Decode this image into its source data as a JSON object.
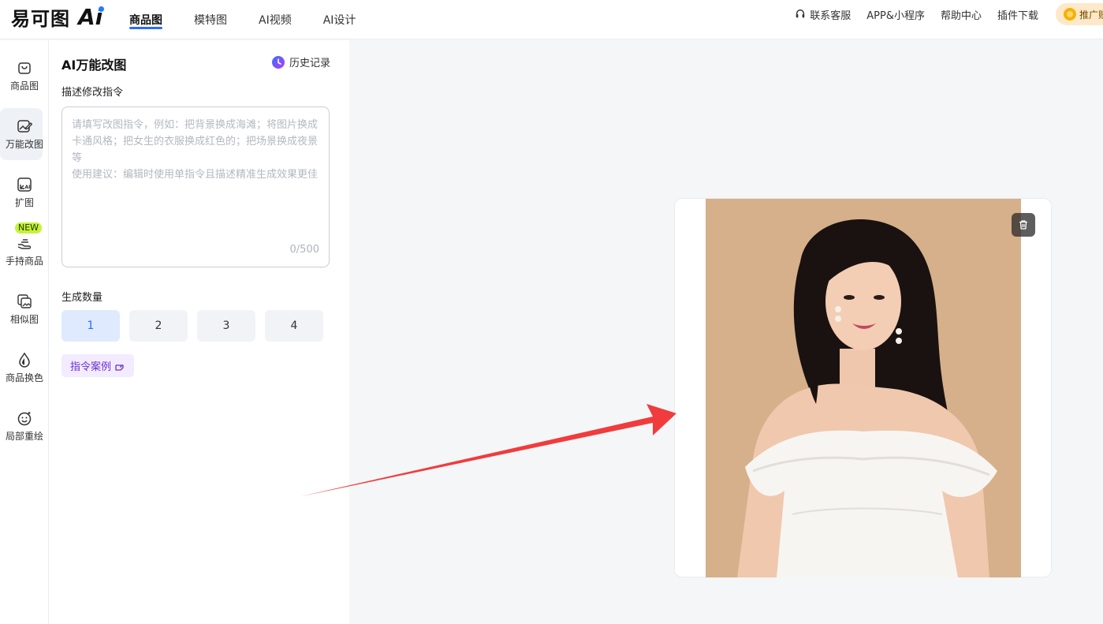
{
  "brand": {
    "logo_text": "易可图",
    "logo_ai": "Ai"
  },
  "nav": {
    "items": [
      {
        "label": "商品图",
        "active": true
      },
      {
        "label": "模特图",
        "active": false
      },
      {
        "label": "AI视频",
        "active": false
      },
      {
        "label": "AI设计",
        "active": false
      }
    ]
  },
  "header_right": {
    "support": "联系客服",
    "app": "APP&小程序",
    "help": "帮助中心",
    "plugin": "插件下载",
    "promo": "推广赚"
  },
  "sidebar": {
    "items": [
      {
        "label": "商品图",
        "icon": "bag-icon"
      },
      {
        "label": "万能改图",
        "icon": "edit-image-icon",
        "active": true
      },
      {
        "label": "扩图",
        "icon": "expand-image-icon"
      },
      {
        "label": "手持商品",
        "icon": "hand-product-icon",
        "badge": "NEW"
      },
      {
        "label": "相似图",
        "icon": "similar-image-icon"
      },
      {
        "label": "商品换色",
        "icon": "color-drop-icon"
      },
      {
        "label": "局部重绘",
        "icon": "smiley-icon"
      }
    ]
  },
  "panel": {
    "title": "AI万能改图",
    "history": "历史记录",
    "prompt_label": "描述修改指令",
    "prompt_placeholder": "请填写改图指令，例如：把背景换成海滩；将图片换成卡通风格；把女生的衣服换成红色的；把场景换成夜景等\n使用建议：编辑时使用单指令且描述精准生成效果更佳",
    "prompt_counter": "0/500",
    "count_label": "生成数量",
    "count_options": [
      "1",
      "2",
      "3",
      "4"
    ],
    "count_selected": "1",
    "example_button": "指令案例"
  },
  "colors": {
    "accent": "#2b6cff",
    "arrow": "#f03c3c",
    "photo_bg": "#d6b08a",
    "new_badge": "#c6f23a"
  }
}
